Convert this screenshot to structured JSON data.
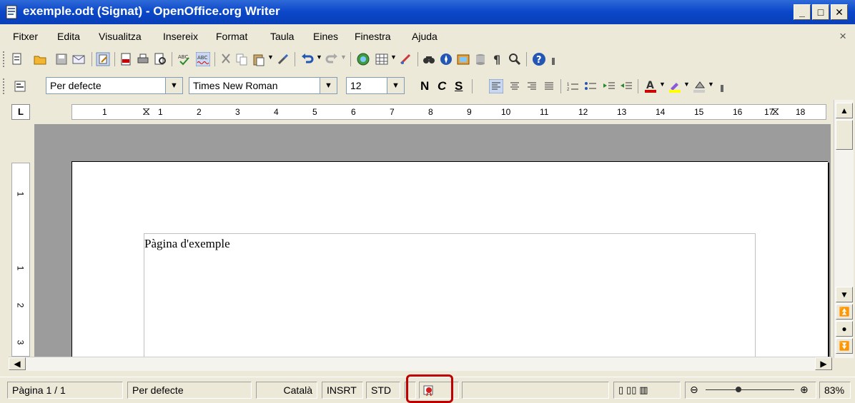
{
  "window": {
    "title": "exemple.odt (Signat) - OpenOffice.org Writer",
    "minimize": "_",
    "maximize": "□",
    "close": "✕"
  },
  "menu": {
    "items": [
      "Fitxer",
      "Edita",
      "Visualitza",
      "Insereix",
      "Format",
      "Taula",
      "Eines",
      "Finestra",
      "Ajuda"
    ],
    "doc_close": "×"
  },
  "toolbar_format": {
    "style": "Per defecte",
    "font": "Times New Roman",
    "size": "12",
    "bold": "N",
    "italic": "C",
    "underline": "S"
  },
  "ruler": {
    "corner": "L",
    "h_numbers": [
      "1",
      "1",
      "2",
      "3",
      "4",
      "5",
      "6",
      "7",
      "8",
      "9",
      "10",
      "11",
      "12",
      "13",
      "14",
      "15",
      "16",
      "17",
      "18"
    ],
    "v_numbers": [
      "1",
      "1",
      "2",
      "3"
    ]
  },
  "document": {
    "text": "Pàgina d'exemple"
  },
  "statusbar": {
    "page": "Pàgina  1 / 1",
    "style": "Per defecte",
    "language": "Català",
    "insert_mode": "INSRT",
    "selection_mode": "STD",
    "zoom": "83%"
  },
  "icons": {
    "app": "writer-icon",
    "signature": "digital-signature-icon"
  },
  "colors": {
    "titlebar": "#0a47c9",
    "highlight": "#c00000",
    "canvas": "#9c9c9c"
  }
}
